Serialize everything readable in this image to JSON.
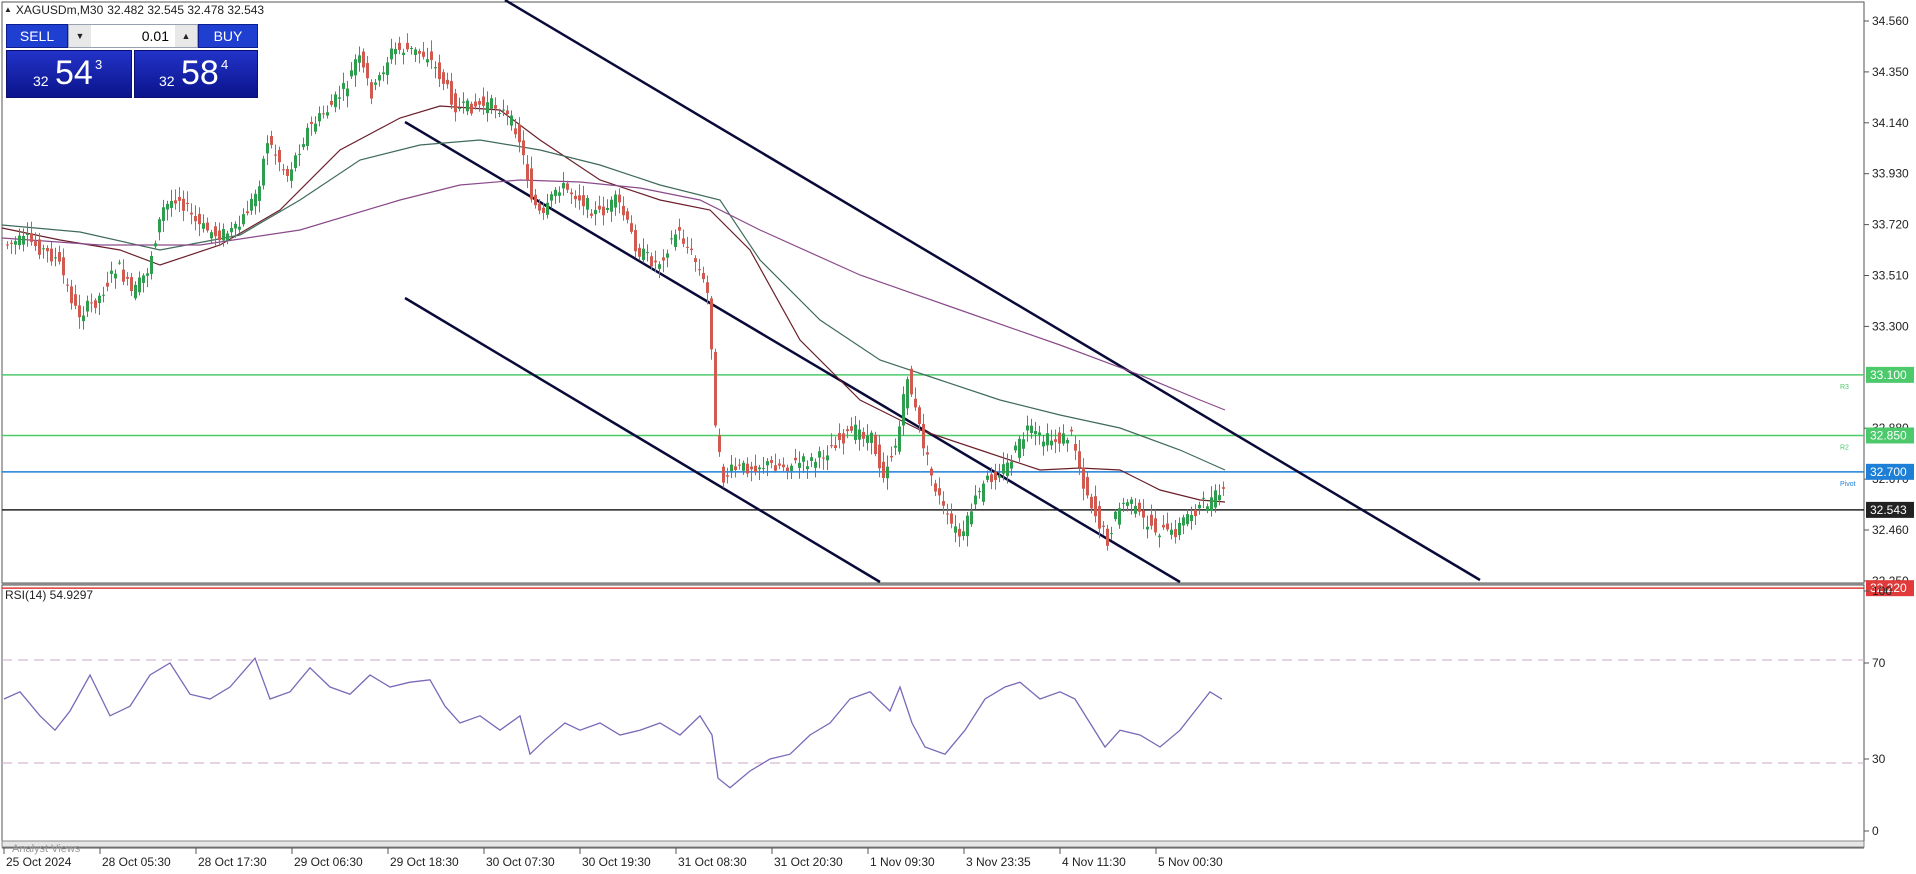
{
  "header": {
    "symbol": "XAGUSDm,M30",
    "ohlc": "32.482 32.545 32.478 32.543"
  },
  "trade_panel": {
    "sell_label": "SELL",
    "buy_label": "BUY",
    "lot_value": "0.01",
    "sell_price": {
      "prefix": "32",
      "big": "54",
      "sup": "3"
    },
    "buy_price": {
      "prefix": "32",
      "big": "58",
      "sup": "4"
    },
    "button_color": "#1f3fd1"
  },
  "price_axis": {
    "labels": [
      "34.560",
      "34.350",
      "34.140",
      "33.930",
      "33.720",
      "33.510",
      "33.300",
      "32.880",
      "32.670",
      "32.460",
      "32.250"
    ],
    "values": [
      34.56,
      34.35,
      34.14,
      33.93,
      33.72,
      33.51,
      33.3,
      32.88,
      32.67,
      32.46,
      32.25
    ]
  },
  "levels": [
    {
      "label": "33.100",
      "value": 33.1,
      "color": "#4cc96b",
      "tag": "R3"
    },
    {
      "label": "32.850",
      "value": 32.85,
      "color": "#4cc96b",
      "tag": "R2"
    },
    {
      "label": "32.700",
      "value": 32.7,
      "color": "#1e7fd6",
      "tag": "Pivot"
    },
    {
      "label": "32.543",
      "value": 32.543,
      "color": "#222222",
      "tag": ""
    },
    {
      "label": "32.220",
      "value": 32.22,
      "color": "#e03a3a",
      "tag": ""
    }
  ],
  "rsi": {
    "label": "RSI(14) 54.9297",
    "axis_labels": [
      "100",
      "70",
      "30",
      "0"
    ],
    "axis_values": [
      100,
      70,
      30,
      0
    ],
    "line_color": "#7b68b8"
  },
  "time_axis": {
    "labels": [
      "25 Oct 2024",
      "28 Oct 05:30",
      "28 Oct 17:30",
      "29 Oct 06:30",
      "29 Oct 18:30",
      "30 Oct 07:30",
      "30 Oct 19:30",
      "31 Oct 08:30",
      "31 Oct 20:30",
      "1 Nov 09:30",
      "3 Nov 23:35",
      "4 Nov 11:30",
      "5 Nov 00:30"
    ]
  },
  "footer": {
    "analyst_views": "Analyst Views"
  },
  "chart_data": [
    {
      "type": "candlestick",
      "title": "",
      "symbol": "XAGUSDm,M30",
      "ylim": [
        32.19,
        34.62
      ],
      "key_points": [
        {
          "x": "25 Oct 2024",
          "y": 33.65
        },
        {
          "x": "28 Oct 05:30",
          "y": 33.42
        },
        {
          "x": "28 Oct 17:30",
          "y": 33.7
        },
        {
          "x": "29 Oct 06:30",
          "y": 34.2
        },
        {
          "x": "29 Oct 18:30",
          "y": 34.4
        },
        {
          "x": "30 Oct 07:30",
          "y": 33.75
        },
        {
          "x": "30 Oct 19:30",
          "y": 33.6
        },
        {
          "x": "31 Oct 08:30",
          "y": 32.55
        },
        {
          "x": "31 Oct 20:30",
          "y": 32.78
        },
        {
          "x": "1 Nov 09:30",
          "y": 32.95
        },
        {
          "x": "3 Nov 23:35",
          "y": 32.62
        },
        {
          "x": "4 Nov 11:30",
          "y": 32.4
        },
        {
          "x": "5 Nov 00:30",
          "y": 32.543
        }
      ],
      "last_price": 32.543,
      "moving_averages": [
        "ma-fast",
        "ma-medium",
        "ma-slow"
      ],
      "channel_lines": 3
    },
    {
      "type": "line",
      "title": "RSI(14) 54.9297",
      "ylim": [
        0,
        100
      ],
      "levels": [
        70,
        30
      ],
      "last_value": 54.9297
    }
  ]
}
